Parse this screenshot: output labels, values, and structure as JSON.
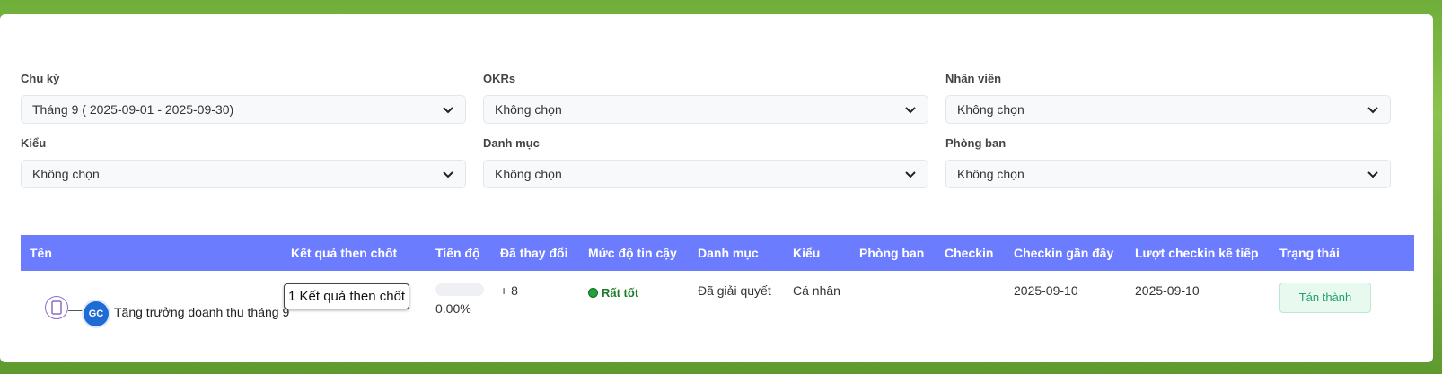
{
  "filters": [
    {
      "label": "Chu kỳ",
      "value": "Tháng 9 ( 2025-09-01 - 2025-09-30)"
    },
    {
      "label": "OKRs",
      "value": "Không chọn"
    },
    {
      "label": "Nhân viên",
      "value": "Không chọn"
    },
    {
      "label": "Kiểu",
      "value": "Không chọn"
    },
    {
      "label": "Danh mục",
      "value": "Không chọn"
    },
    {
      "label": "Phòng ban",
      "value": "Không chọn"
    }
  ],
  "table": {
    "headers": [
      "Tên",
      "Kết quả then chốt",
      "Tiến độ",
      "Đã thay đổi",
      "Mức độ tin cậy",
      "Danh mục",
      "Kiểu",
      "Phòng ban",
      "Checkin",
      "Checkin gần đây",
      "Lượt checkin kế tiếp",
      "Trạng thái"
    ],
    "rows": [
      {
        "logo_text": "GC",
        "name": "Tăng trưởng doanh thu tháng 9",
        "key_results": "1 Kết quả then chốt",
        "progress": "0.00%",
        "changed": "+ 8",
        "confidence": "Rất tốt",
        "category": "Đã giải quyết",
        "type": "Cá nhân",
        "department": "",
        "checkin": "",
        "last_checkin": "2025-09-10",
        "next_checkin": "2025-09-10",
        "status": "Tán thành"
      }
    ]
  },
  "colors": {
    "header_bg": "#6b7cff",
    "confidence_dot": "#22a13b",
    "status_text": "#20a36a"
  }
}
